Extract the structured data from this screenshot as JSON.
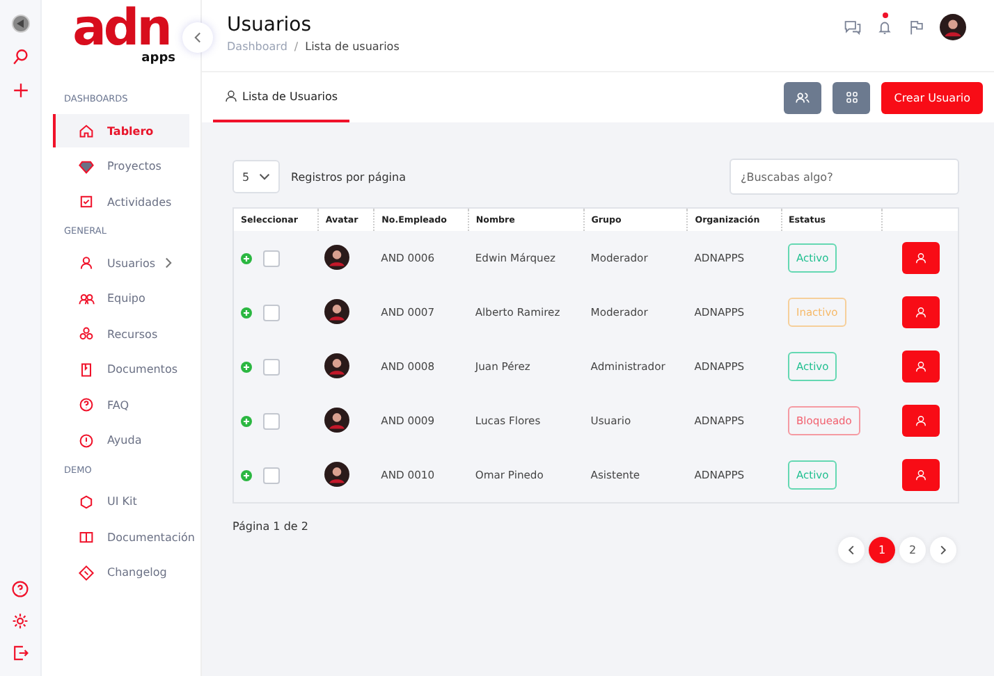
{
  "logo": {
    "main": "adn",
    "sub": "apps"
  },
  "sidebar": {
    "sections": [
      {
        "title": "DASHBOARDS",
        "items": [
          {
            "label": "Tablero",
            "selected": true
          },
          {
            "label": "Proyectos",
            "selected": false
          },
          {
            "label": "Actividades",
            "selected": false
          }
        ]
      },
      {
        "title": "GENERAL",
        "items": [
          {
            "label": "Usuarios",
            "selected": false,
            "submenu": true
          },
          {
            "label": "Equipo",
            "selected": false
          },
          {
            "label": "Recursos",
            "selected": false
          },
          {
            "label": "Documentos",
            "selected": false
          },
          {
            "label": "FAQ",
            "selected": false
          },
          {
            "label": "Ayuda",
            "selected": false
          }
        ]
      },
      {
        "title": "DEMO",
        "items": [
          {
            "label": "UI Kit",
            "selected": false
          },
          {
            "label": "Documentación",
            "selected": false
          },
          {
            "label": "Changelog",
            "selected": false
          }
        ]
      }
    ]
  },
  "header": {
    "title": "Usuarios",
    "breadcrumb": [
      "Dashboard",
      "Lista de usuarios"
    ],
    "breadcrumb_separator": "/",
    "notification": true
  },
  "tabs": [
    {
      "label": "Lista de Usuarios",
      "selected": true
    }
  ],
  "create_button": "Crear Usuario",
  "page_size": "5",
  "page_size_label": "Registros por página",
  "search": {
    "placeholder": "¿Buscabas algo?"
  },
  "table": {
    "columns": [
      "Seleccionar",
      "Avatar",
      "No.Empleado",
      "Nombre",
      "Grupo",
      "Organización",
      "Estatus"
    ],
    "rows": [
      {
        "id": "AND 0006",
        "name": "Edwin Márquez",
        "group": "Moderador",
        "org": "ADNAPPS",
        "status": "Activo",
        "kind": "active",
        "checked": false
      },
      {
        "id": "AND 0007",
        "name": "Alberto Ramirez",
        "group": "Moderador",
        "org": "ADNAPPS",
        "status": "Inactivo",
        "kind": "inactive",
        "checked": false
      },
      {
        "id": "AND 0008",
        "name": "Juan Pérez",
        "group": "Administrador",
        "org": "ADNAPPS",
        "status": "Activo",
        "kind": "active",
        "checked": false
      },
      {
        "id": "AND 0009",
        "name": "Lucas Flores",
        "group": "Usuario",
        "org": "ADNAPPS",
        "status": "Bloqueado",
        "kind": "blocked",
        "checked": false
      },
      {
        "id": "AND 0010",
        "name": "Omar Pinedo",
        "group": "Asistente",
        "org": "ADNAPPS",
        "status": "Activo",
        "kind": "active",
        "checked": false
      }
    ]
  },
  "page_info": "Página 1 de 2",
  "pages": [
    {
      "label": "1",
      "selected": true
    },
    {
      "label": "2",
      "selected": false
    }
  ]
}
